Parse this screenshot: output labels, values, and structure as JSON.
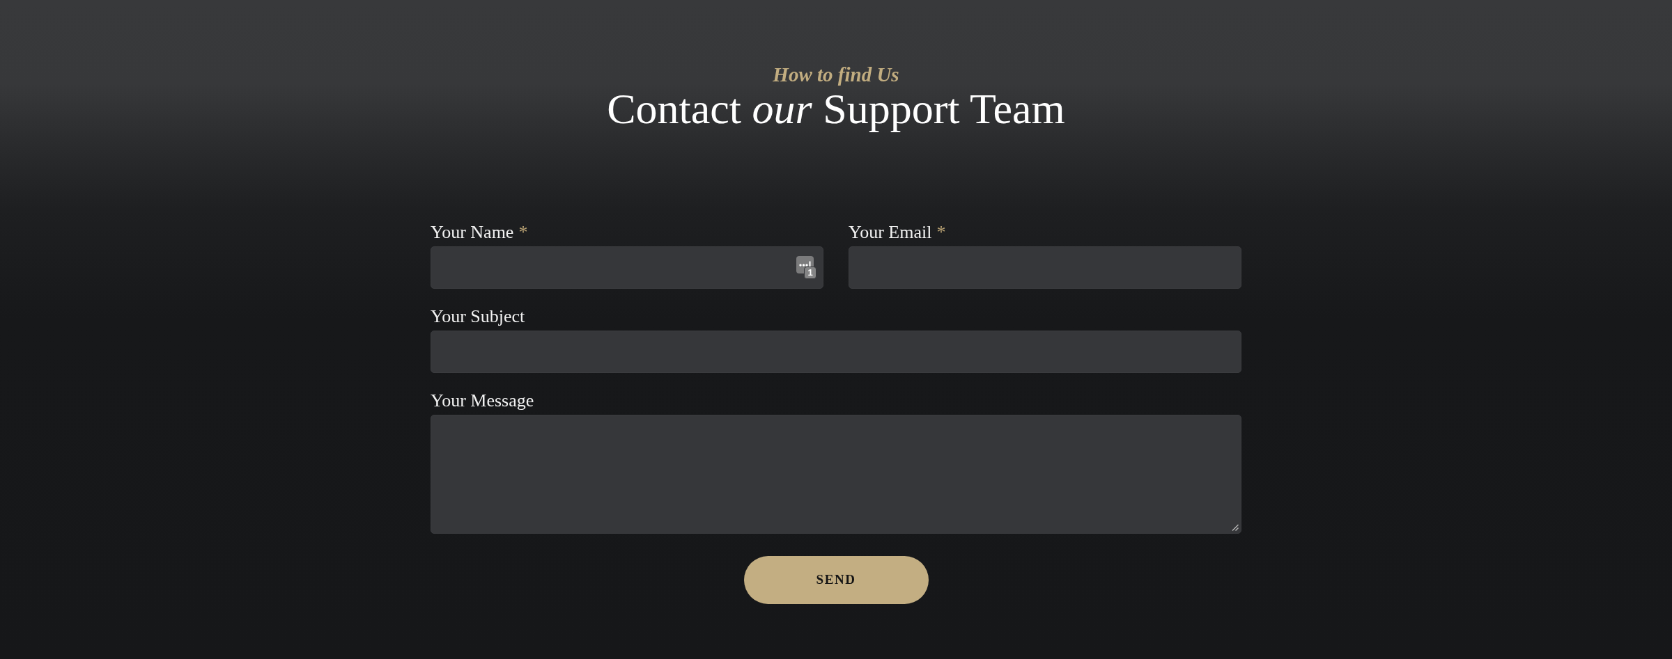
{
  "header": {
    "eyebrow": "How to find Us",
    "title": "Contact *our* Support Team"
  },
  "form": {
    "required_mark": "*",
    "rows": [
      {
        "fields": [
          {
            "kind": "input",
            "label": "Your Name",
            "required": true,
            "autofill_badge": "1"
          },
          {
            "kind": "input",
            "label": "Your Email",
            "required": true
          }
        ]
      },
      {
        "fields": [
          {
            "kind": "input",
            "label": "Your Subject",
            "required": false
          }
        ]
      },
      {
        "fields": [
          {
            "kind": "textarea",
            "label": "Your Message",
            "required": false
          }
        ]
      }
    ],
    "submit": {
      "label": "SEND"
    }
  }
}
